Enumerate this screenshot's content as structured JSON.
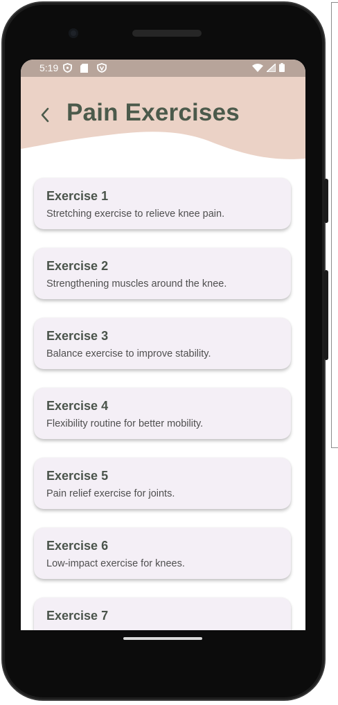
{
  "status_bar": {
    "time": "5:19"
  },
  "header": {
    "title": "Pain Exercises",
    "back_icon": "chevron-left-icon"
  },
  "exercises": [
    {
      "title": "Exercise 1",
      "description": "Stretching exercise to relieve knee pain."
    },
    {
      "title": "Exercise 2",
      "description": "Strengthening muscles around the knee."
    },
    {
      "title": "Exercise 3",
      "description": "Balance exercise to improve stability."
    },
    {
      "title": "Exercise 4",
      "description": "Flexibility routine for better mobility."
    },
    {
      "title": "Exercise 5",
      "description": "Pain relief exercise for joints."
    },
    {
      "title": "Exercise 6",
      "description": "Low-impact exercise for knees."
    },
    {
      "title": "Exercise 7",
      "description": ""
    }
  ],
  "colors": {
    "status_bar": "#b7a49a",
    "header_bg": "#ebd2c6",
    "title_text": "#4b5a4b",
    "card_bg": "#f4eff6"
  }
}
